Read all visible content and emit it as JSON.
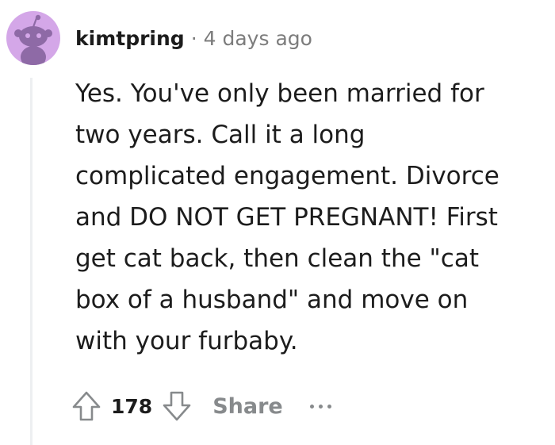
{
  "comment": {
    "author": "kimtpring",
    "separator": "·",
    "timestamp": "4 days ago",
    "avatar_color": "#d4a7e8",
    "body_lines": [
      "Yes. You've only been married for",
      "two years. Call it a long",
      "complicated engagement. Divorce",
      "and DO NOT GET PREGNANT! First",
      "get cat back, then clean the \"cat",
      "box of a husband\" and move on",
      "with your furbaby."
    ],
    "score": "178",
    "share_label": "Share",
    "icons": {
      "avatar": "snoo-avatar-icon",
      "upvote": "upvote-arrow-icon",
      "downvote": "downvote-arrow-icon",
      "more": "more-options-icon"
    }
  }
}
